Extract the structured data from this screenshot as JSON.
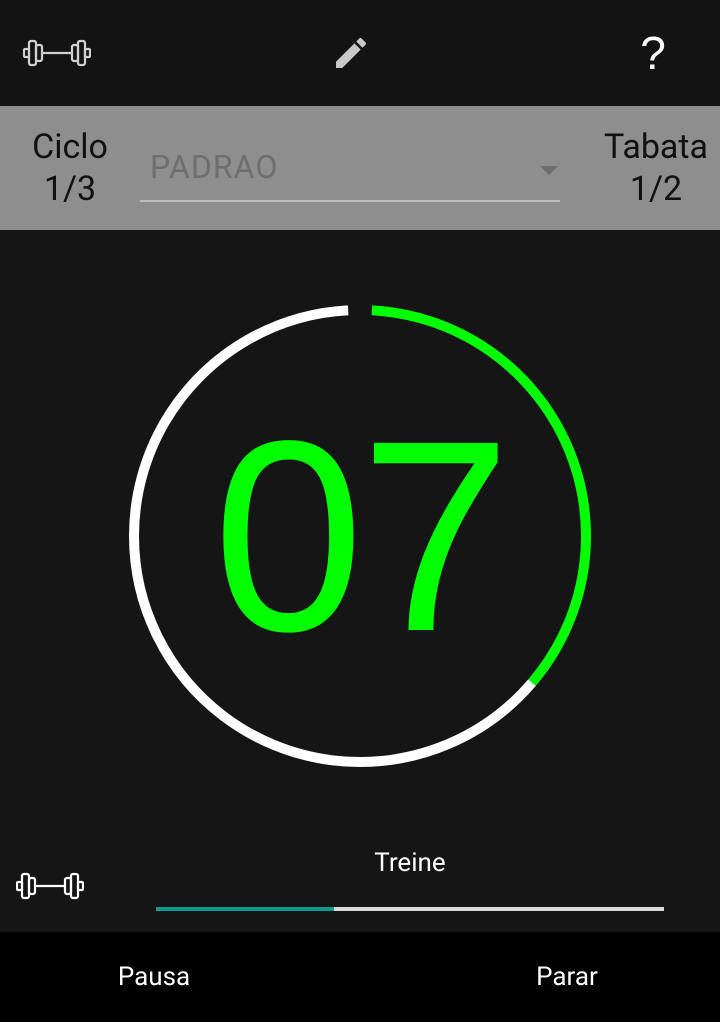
{
  "toolbar": {
    "left_icon": "dumbbell-icon",
    "center_icon": "pencil-icon",
    "help_label": "?"
  },
  "info": {
    "cycle_label": "Ciclo",
    "cycle_value": "1/3",
    "preset_value": "PADRAO",
    "tabata_label": "Tabata",
    "tabata_value": "1/2"
  },
  "timer": {
    "digits": "07",
    "progress_fraction": 0.36,
    "colors": {
      "remaining": "#00ff00",
      "elapsed": "#ffffff"
    }
  },
  "phase": {
    "label": "Treine",
    "progress_fraction": 0.35,
    "icon": "dumbbell-icon"
  },
  "actions": {
    "pause_label": "Pausa",
    "stop_label": "Parar"
  },
  "colors": {
    "background": "#151515",
    "info_bar": "#8e8e8e",
    "accent_green": "#00ff00",
    "phase_accent": "#0f9c8e"
  }
}
